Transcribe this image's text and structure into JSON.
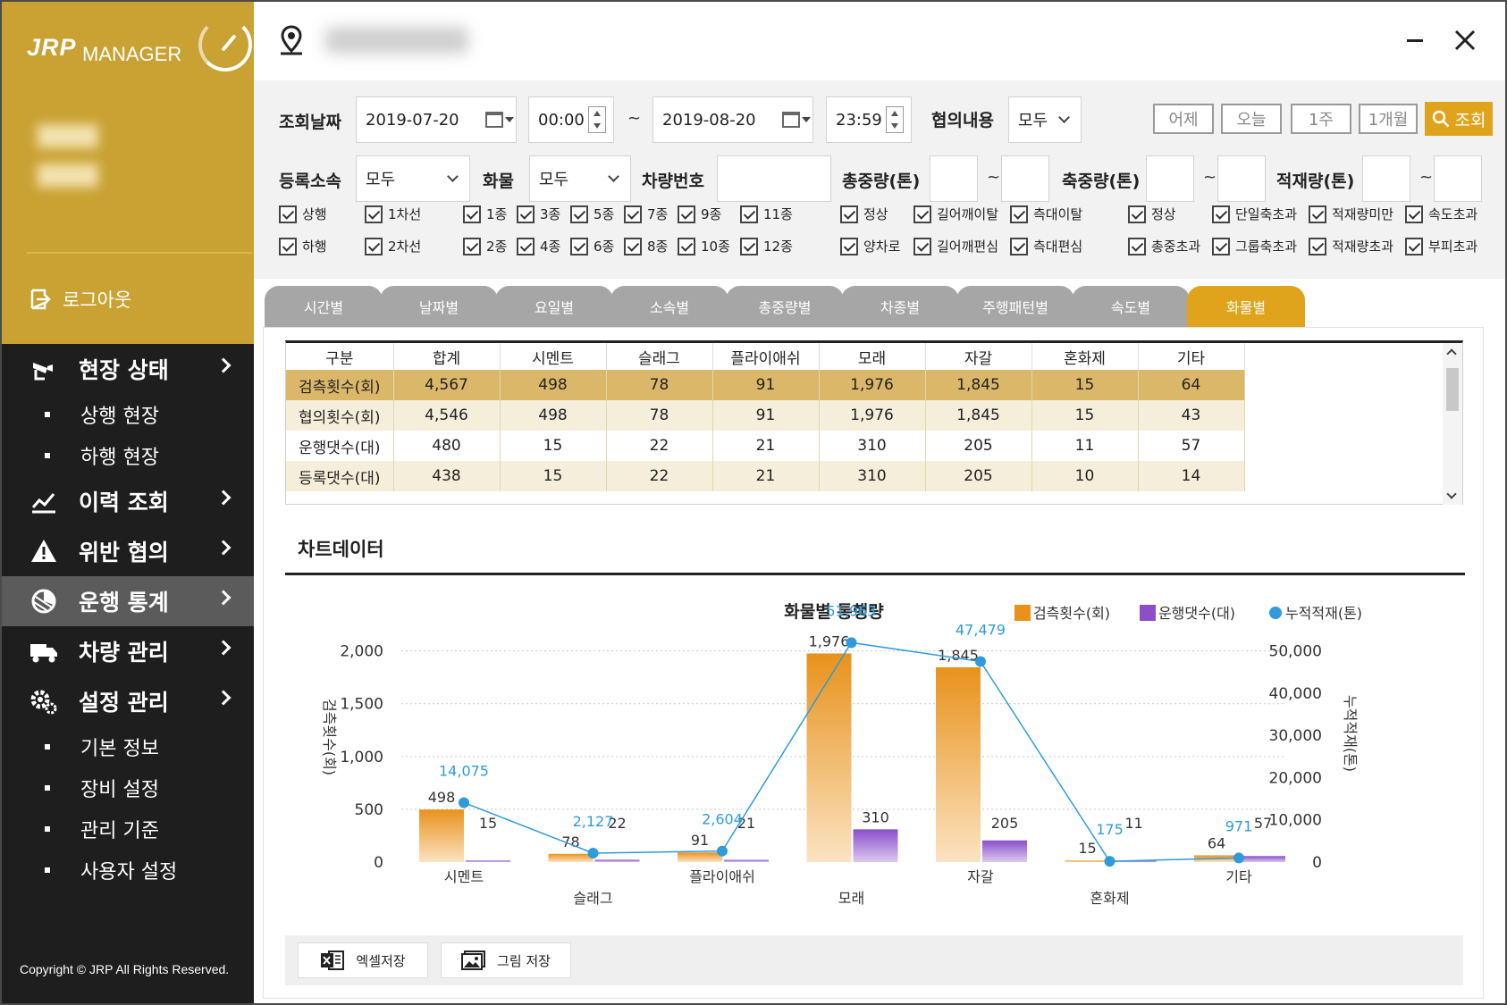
{
  "app": {
    "logo": "JRP",
    "logo_sub": "MANAGER"
  },
  "sidebar": {
    "logout": "로그아웃",
    "menu": [
      {
        "label": "현장 상태",
        "icon": "camera-icon",
        "has_sub": true,
        "sub": [
          "상행 현장",
          "하행 현장"
        ]
      },
      {
        "label": "이력 조회",
        "icon": "line-chart-icon",
        "sub": []
      },
      {
        "label": "위반 협의",
        "icon": "warning-icon",
        "sub": []
      },
      {
        "label": "운행 통계",
        "icon": "stats-icon",
        "active": true,
        "sub": []
      },
      {
        "label": "차량 관리",
        "icon": "truck-icon",
        "sub": []
      },
      {
        "label": "설정 관리",
        "icon": "gear-icon",
        "sub": [
          "기본 정보",
          "장비 설정",
          "관리 기준",
          "사용자 설정"
        ]
      }
    ],
    "copyright": "Copyright © JRP All Rights Reserved."
  },
  "filters": {
    "date_label": "조회날짜",
    "start_date": "2019-07-20",
    "start_time": "00:00",
    "tilde": "~",
    "end_date": "2019-08-20",
    "end_time": "23:59",
    "consult_label": "협의내용",
    "consult_value": "모두",
    "quick": [
      "어제",
      "오늘",
      "1주",
      "1개월"
    ],
    "search": "조회",
    "org_label": "등록소속",
    "org_value": "모두",
    "cargo_label": "화물",
    "cargo_value": "모두",
    "plate_label": "차량번호",
    "total_weight_label": "총중량(톤)",
    "axle_weight_label": "축중량(톤)",
    "load_label": "적재량(톤)"
  },
  "checkboxes": {
    "direction": [
      "상행",
      "하행"
    ],
    "lane": [
      "1차선",
      "2차선"
    ],
    "vehicle_types": [
      "1종",
      "3종",
      "5종",
      "7종",
      "9종",
      "11종",
      "2종",
      "4종",
      "6종",
      "8종",
      "10종",
      "12종"
    ],
    "driving": [
      "정상",
      "길어깨이탈",
      "측대이탈",
      "양차로",
      "길어깨편심",
      "측대편심"
    ],
    "weight": [
      "정상",
      "단일축초과",
      "적재량미만",
      "속도초과",
      "총중초과",
      "그룹축초과",
      "적재량초과",
      "부피초과"
    ]
  },
  "tabs": [
    "시간별",
    "날짜별",
    "요일별",
    "소속별",
    "총중량별",
    "차종별",
    "주행패턴별",
    "속도별",
    "화물별"
  ],
  "active_tab": 8,
  "table": {
    "headers": [
      "구분",
      "합계",
      "시멘트",
      "슬래그",
      "플라이애쉬",
      "모래",
      "자갈",
      "혼화제",
      "기타"
    ],
    "rows": [
      [
        "검측횟수(회)",
        "4,567",
        "498",
        "78",
        "91",
        "1,976",
        "1,845",
        "15",
        "64"
      ],
      [
        "협의횟수(회)",
        "4,546",
        "498",
        "78",
        "91",
        "1,976",
        "1,845",
        "15",
        "43"
      ],
      [
        "운행댓수(대)",
        "480",
        "15",
        "22",
        "21",
        "310",
        "205",
        "11",
        "57"
      ],
      [
        "등록댓수(대)",
        "438",
        "15",
        "22",
        "21",
        "310",
        "205",
        "10",
        "14"
      ]
    ]
  },
  "chart_section_title": "차트데이터",
  "chart_data": {
    "type": "bar",
    "title": "화물별 통행량",
    "categories": [
      "시멘트",
      "슬래그",
      "플라이애쉬",
      "모래",
      "자갈",
      "혼화제",
      "기타"
    ],
    "series": [
      {
        "name": "검측횟수(회)",
        "type": "bar",
        "axis": "left",
        "color": "#e8921c",
        "values": [
          498,
          78,
          91,
          1976,
          1845,
          15,
          64
        ]
      },
      {
        "name": "운행댓수(대)",
        "type": "bar",
        "axis": "left",
        "color": "#8a4fc9",
        "values": [
          15,
          22,
          21,
          310,
          205,
          11,
          57
        ]
      },
      {
        "name": "누적적재(톤)",
        "type": "line",
        "axis": "right",
        "color": "#2f9bdb",
        "values": [
          14075,
          2127,
          2604,
          51963,
          47479,
          175,
          971
        ]
      }
    ],
    "ylabel": "검측횟수(회)",
    "y2label": "누적적재(톤)",
    "ylim": [
      0,
      2200
    ],
    "yticks": [
      "0",
      "500",
      "1,000",
      "1,500",
      "2,000"
    ],
    "y2lim": [
      0,
      55000
    ],
    "y2ticks": [
      "0",
      "10,000",
      "20,000",
      "30,000",
      "40,000",
      "50,000"
    ],
    "legend": "top-right",
    "grid": true
  },
  "buttons": {
    "excel": "엑셀저장",
    "image": "그림 저장"
  }
}
